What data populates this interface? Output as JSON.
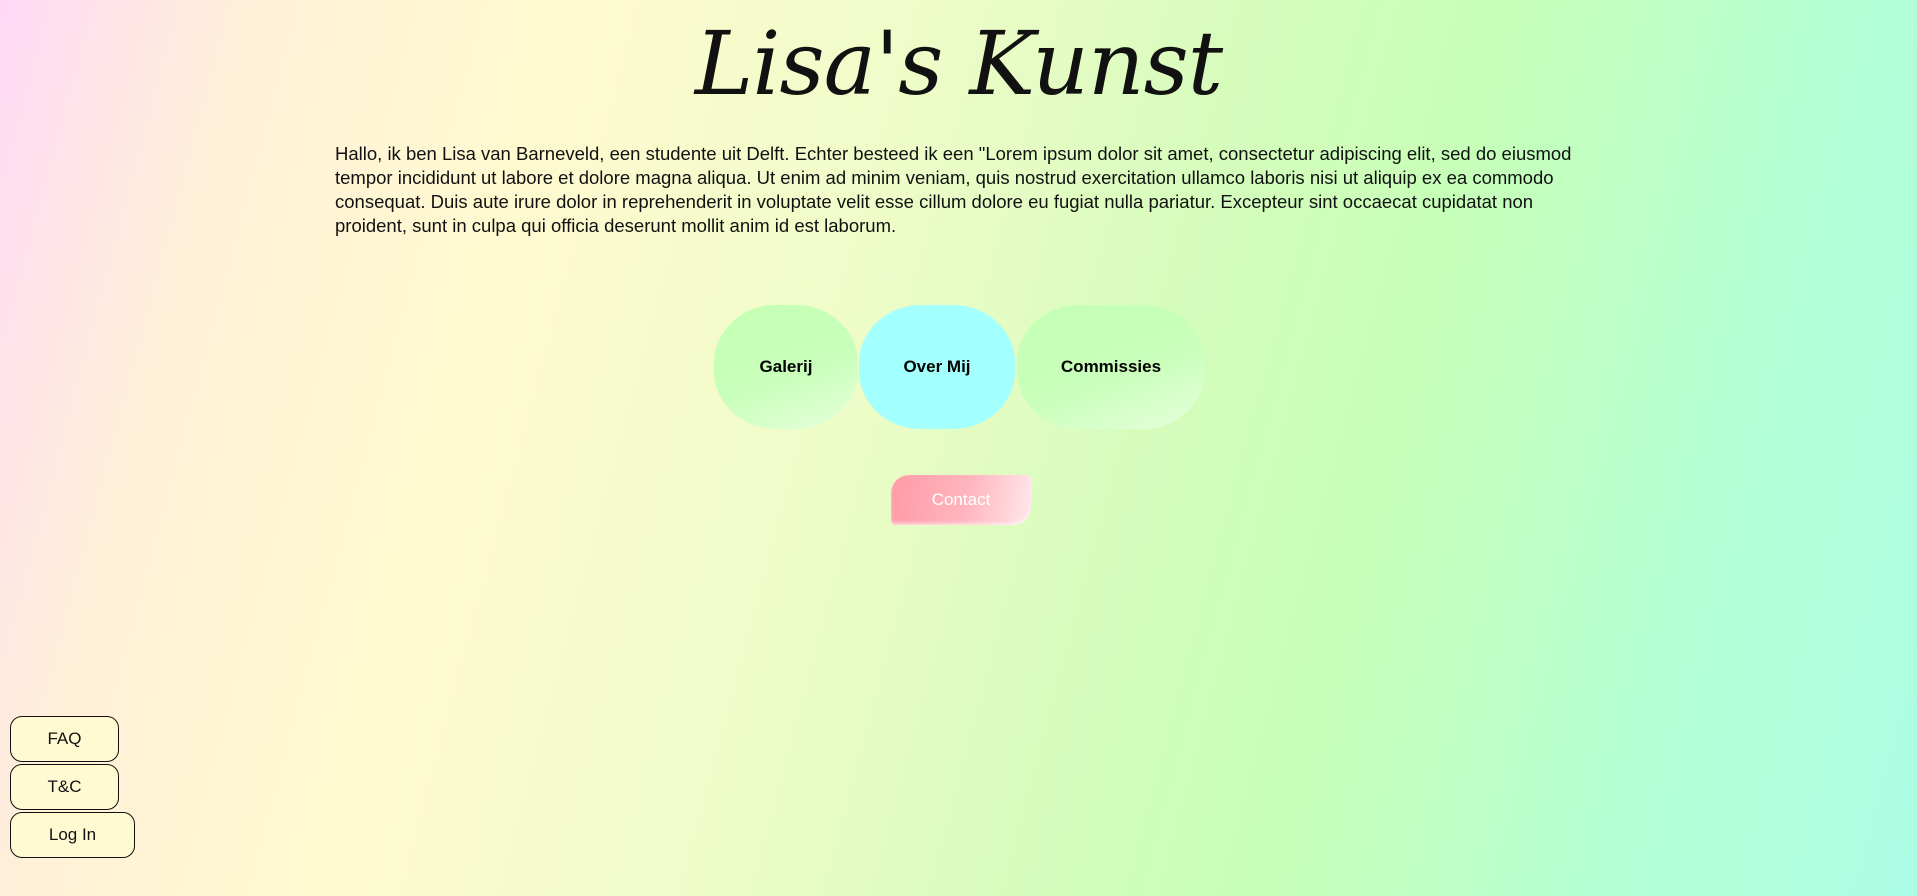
{
  "header": {
    "title": "Lisa's Kunst"
  },
  "intro": {
    "text": "Hallo, ik ben Lisa van Barneveld, een studente uit Delft. Echter besteed ik een \"Lorem ipsum dolor sit amet, consectetur adipiscing elit, sed do eiusmod tempor incididunt ut labore et dolore magna aliqua. Ut enim ad minim veniam, quis nostrud exercitation ullamco laboris nisi ut aliquip ex ea commodo consequat. Duis aute irure dolor in reprehenderit in voluptate velit esse cillum dolore eu fugiat nulla pariatur. Excepteur sint occaecat cupidatat non proident, sunt in culpa qui officia deserunt mollit anim id est laborum."
  },
  "nav": {
    "galerij": "Galerij",
    "over_mij": "Over Mij",
    "commissies": "Commissies"
  },
  "contact": {
    "label": "Contact"
  },
  "footer": {
    "faq": "FAQ",
    "tc": "T&C",
    "login": "Log In"
  },
  "colors": {
    "nav_active": "#a4ffff",
    "nav_default": "#c4ffb4",
    "contact": "#ff9aa6",
    "footer_button": "#fffad2"
  }
}
